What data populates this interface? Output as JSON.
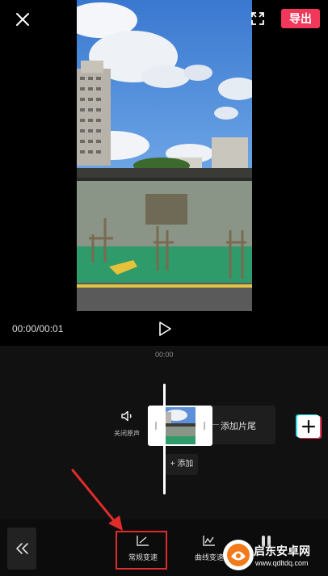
{
  "header": {
    "close_icon": "close-icon",
    "fullscreen_icon": "fullscreen-icon",
    "export_label": "导出"
  },
  "player": {
    "timecode": "00:00/00:01",
    "play_icon": "play-icon"
  },
  "timeline": {
    "ruler_time": "00:00",
    "mute_label": "关闭原声",
    "add_ending_label": "添加片尾",
    "add_audio_label": "+ 添加",
    "add_clip_icon": "plus-icon"
  },
  "toolbar": {
    "back_icon": "double-chevron-left-icon",
    "normal_speed_label": "常规变速",
    "curve_speed_label": "曲线变速"
  },
  "watermark": {
    "title": "启东安卓网",
    "url": "www.qdltdq.com"
  },
  "colors": {
    "accent": "#f2385a",
    "annotation": "#e02b2b"
  }
}
